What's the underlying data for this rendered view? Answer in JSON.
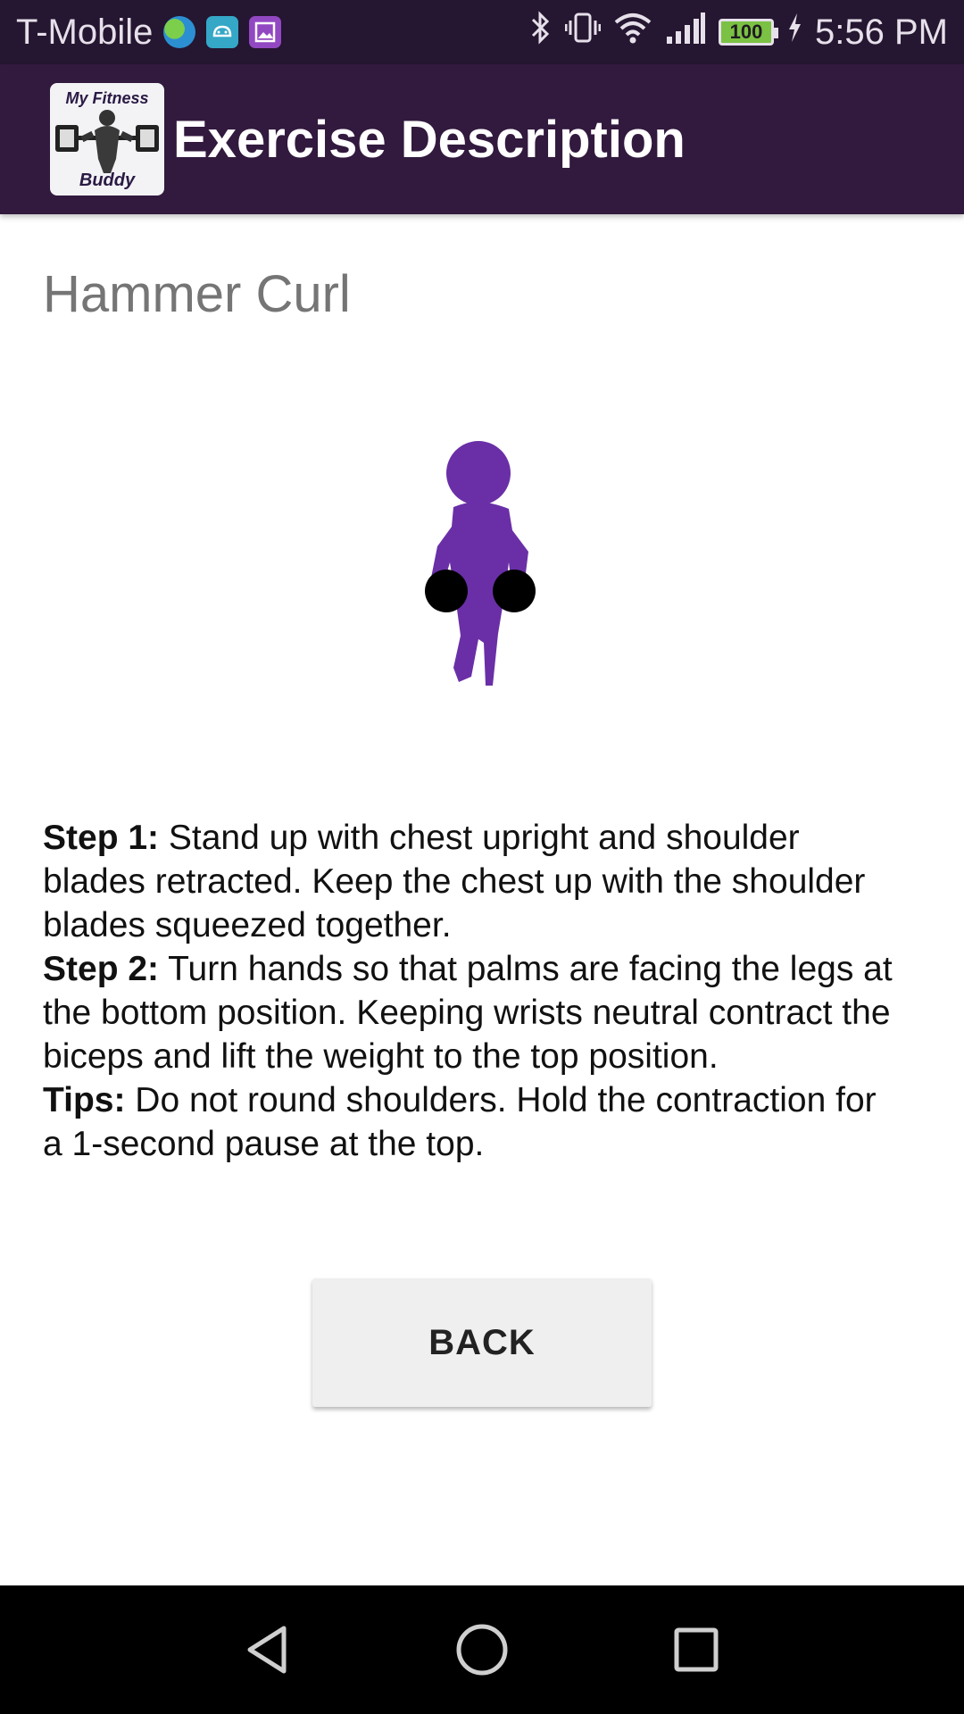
{
  "status_bar": {
    "carrier": "T-Mobile",
    "battery": "100",
    "time": "5:56 PM",
    "notification_icons": [
      "globe-icon",
      "android-icon",
      "gallery-icon"
    ],
    "system_icons": [
      "bluetooth-icon",
      "vibrate-icon",
      "wifi-icon",
      "signal-icon",
      "battery-icon",
      "charging-icon"
    ]
  },
  "app_bar": {
    "logo_text_top": "My Fitness",
    "logo_text_bottom": "Buddy",
    "title": "Exercise Description",
    "background": "#32193e"
  },
  "exercise": {
    "name": "Hammer Curl",
    "figure_color": "#6a2fa7",
    "steps": [
      {
        "label": "Step 1:",
        "text": " Stand up with chest upright and shoulder blades retracted. Keep the chest up with the shoulder blades squeezed together."
      },
      {
        "label": "Step 2:",
        "text": " Turn hands so that palms are facing the legs at the bottom position. Keeping wrists neutral contract the biceps and lift the weight to the top position."
      },
      {
        "label": "Tips:",
        "text": " Do not round shoulders. Hold the contraction for a 1-second pause at the top."
      }
    ]
  },
  "back_button": {
    "label": "BACK"
  },
  "nav_bar": {
    "buttons": [
      "back-nav-icon",
      "home-nav-icon",
      "recents-nav-icon"
    ]
  }
}
